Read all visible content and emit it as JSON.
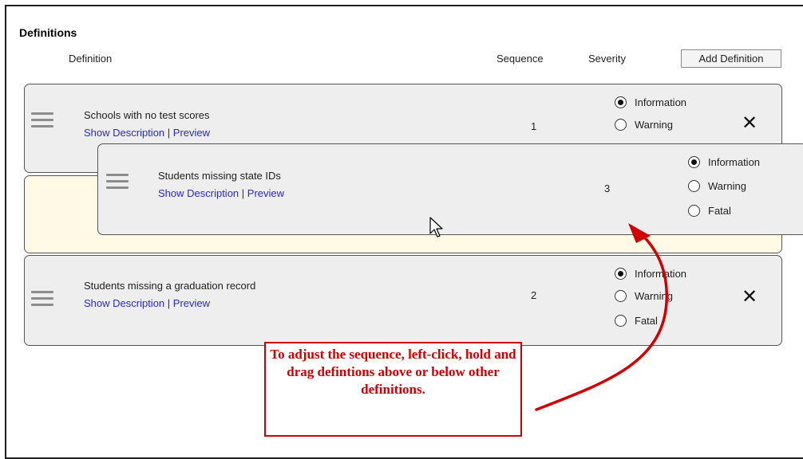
{
  "panel": {
    "title": "Definitions",
    "columns": {
      "definition": "Definition",
      "sequence": "Sequence",
      "severity": "Severity"
    },
    "add_button": "Add Definition"
  },
  "severity_options": [
    "Information",
    "Warning",
    "Fatal"
  ],
  "rows": [
    {
      "name": "Schools with no test scores",
      "show_description": "Show Description",
      "separator": "|",
      "preview": "Preview",
      "sequence": "1",
      "selected": "Information"
    },
    {
      "name": "Students missing state IDs",
      "show_description": "Show Description",
      "separator": "|",
      "preview": "Preview",
      "sequence": "3",
      "selected": "Information",
      "state": "dragging"
    },
    {
      "name": "Students missing a graduation record",
      "show_description": "Show Description",
      "separator": "|",
      "preview": "Preview",
      "sequence": "2",
      "selected": "Information"
    }
  ],
  "delete_glyph": "✕",
  "callout": {
    "text": "To adjust the sequence, left-click, hold and drag defintions above or below other definitions.",
    "color": "#cc0000"
  }
}
